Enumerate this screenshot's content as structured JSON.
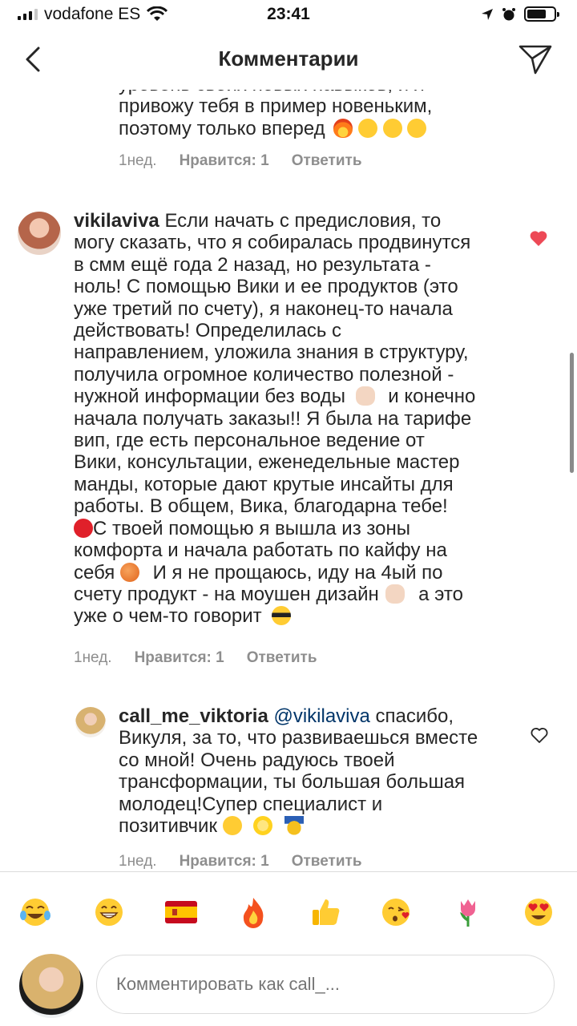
{
  "status": {
    "carrier": "vodafone ES",
    "time": "23:41",
    "battery_level": 0.72
  },
  "header": {
    "title": "Комментарии"
  },
  "comments": [
    {
      "lines": [
        "уровень своих новых навыков, и я",
        "привожу тебя в пример новеньким,",
        "поэтому только вперед"
      ],
      "time": "1нед.",
      "likes": "Нравится: 1",
      "reply": "Ответить"
    },
    {
      "username": "vikilaviva",
      "lines": [
        "Если начать с предисловия, то",
        "могу сказать, что я собиралась продвинутся",
        "в смм ещё года 2 назад, но результата -",
        "ноль! С помощью Вики и ее продуктов (это",
        "уже третий по счету), я наконец-то начала",
        "действовать! Определилась с",
        "направлением, уложила знания в структуру,",
        "получила огромное количество полезной -",
        "нужной информации без воды",
        "и конечно",
        "начала получать заказы!! Я была на тарифе",
        "вип, где есть персональное ведение от",
        "Вики, консультации, еженедельные мастер",
        "манды, которые дают крутые инсайты для",
        "работы. В общем, Вика, благодарна тебе!",
        "С твоей помощью я вышла из зоны",
        "комфорта и начала работать по кайфу на",
        "себя",
        "И я не прощаюсь, иду на 4ый по",
        "счету продукт - на моушен дизайн",
        "а это",
        "уже о чем-то говорит"
      ],
      "time": "1нед.",
      "likes": "Нравится: 1",
      "reply": "Ответить",
      "liked": true
    },
    {
      "username": "call_me_viktoria",
      "mention": "@vikilaviva",
      "lines": [
        "спасибо,",
        "Викуля, за то, что развиваешься вместе",
        "со мной! Очень радуюсь твоей",
        "трансформации, ты большая большая",
        "молодец!Супер специалист и",
        "позитивчик"
      ],
      "time": "1нед.",
      "likes": "Нравится: 1",
      "reply": "Ответить",
      "liked": false
    }
  ],
  "emoji_bar": [
    "tears-of-joy",
    "grinning",
    "spain-flag",
    "fire",
    "thumbs-up",
    "kissing-heart",
    "tulip",
    "heart-eyes"
  ],
  "composer": {
    "placeholder": "Комментировать как call_..."
  },
  "colors": {
    "heart": "#ed4956",
    "meta": "#8e8e8e",
    "mention": "#003569"
  }
}
